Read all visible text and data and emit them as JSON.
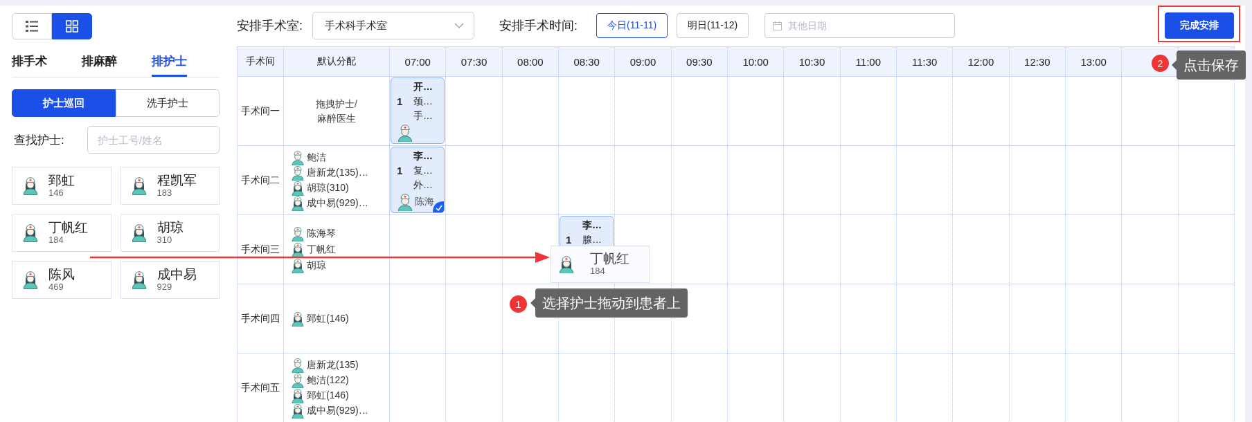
{
  "view_toggle": [
    {
      "kind": "list",
      "selected": false
    },
    {
      "kind": "grid",
      "selected": true
    }
  ],
  "tabs": [
    {
      "label": "排手术",
      "selected": false
    },
    {
      "label": "排麻醉",
      "selected": false
    },
    {
      "label": "排护士",
      "selected": true
    }
  ],
  "nurse_types": [
    {
      "label": "护士巡回",
      "selected": true
    },
    {
      "label": "洗手护士",
      "selected": false
    }
  ],
  "search": {
    "label": "查找护士:",
    "placeholder": "护士工号/姓名"
  },
  "nurses": [
    {
      "name": "郅虹",
      "number": "146",
      "kind": "long"
    },
    {
      "name": "程凯军",
      "number": "183",
      "kind": "long"
    },
    {
      "name": "丁帆红",
      "number": "184",
      "kind": "long"
    },
    {
      "name": "胡琼",
      "number": "310",
      "kind": "long"
    },
    {
      "name": "陈风",
      "number": "469",
      "kind": "long"
    },
    {
      "name": "成中易",
      "number": "929",
      "kind": "long"
    }
  ],
  "toolbar": {
    "room_label": "安排手术室:",
    "room_value": "手术科手术室",
    "time_label": "安排手术时间:",
    "dates": [
      {
        "label": "今日(11-11)",
        "selected": true
      },
      {
        "label": "明日(11-12)",
        "selected": false
      }
    ],
    "date_placeholder": "其他日期",
    "finish_button": "完成安排"
  },
  "schedule": {
    "columns": [
      "手术间",
      "默认分配"
    ],
    "times": [
      "07:00",
      "07:30",
      "08:00",
      "08:30",
      "09:00",
      "09:30",
      "10:00",
      "10:30",
      "11:00",
      "11:30",
      "12:00",
      "12:30",
      "13:00"
    ],
    "rooms": [
      {
        "name": "手术间一",
        "default_note": "拖拽护士/\n麻醉医生",
        "slots": [
          {
            "kind": "surgery",
            "number": "1",
            "lines": [
              "开…",
              "颈…",
              "手…"
            ],
            "nurse": {
              "kind": "short"
            },
            "checked": false
          }
        ]
      },
      {
        "name": "手术间二",
        "assigned": [
          {
            "name": "鲍洁",
            "kind": "short"
          },
          {
            "name": "唐新龙(135)…",
            "kind": "short"
          },
          {
            "name": "胡琼(310)",
            "kind": "long"
          },
          {
            "name": "成中易(929)…",
            "kind": "long"
          }
        ],
        "slots": [
          {
            "kind": "surgery",
            "number": "1",
            "lines": [
              "李…",
              "复…",
              "外…"
            ],
            "nurse": {
              "kind": "short",
              "name": "陈海"
            },
            "checked": true
          }
        ]
      },
      {
        "name": "手术间三",
        "assigned": [
          {
            "name": "陈海琴",
            "kind": "short"
          },
          {
            "name": "丁帆红",
            "kind": "long"
          },
          {
            "name": "胡琼",
            "kind": "long"
          }
        ],
        "slots": [
          {
            "kind": "empty"
          },
          {
            "kind": "empty"
          },
          {
            "kind": "empty"
          },
          {
            "kind": "surgery",
            "number": "1",
            "lines": [
              "李…",
              "腺…"
            ],
            "checked": false
          }
        ]
      },
      {
        "name": "手术间四",
        "assigned": [
          {
            "name": "郅虹(146)",
            "kind": "long"
          }
        ]
      },
      {
        "name": "手术间五",
        "assigned": [
          {
            "name": "唐新龙(135)",
            "kind": "short"
          },
          {
            "name": "鲍洁(122)",
            "kind": "short"
          },
          {
            "name": "郅虹(146)",
            "kind": "long"
          },
          {
            "name": "成中易(929)…",
            "kind": "long"
          }
        ]
      }
    ]
  },
  "drag_preview": {
    "name": "丁帆红",
    "number": "184",
    "kind": "long"
  },
  "callouts": [
    {
      "number": "1",
      "text": "选择护士拖动到患者上"
    },
    {
      "number": "2",
      "text": "点击保存"
    }
  ]
}
